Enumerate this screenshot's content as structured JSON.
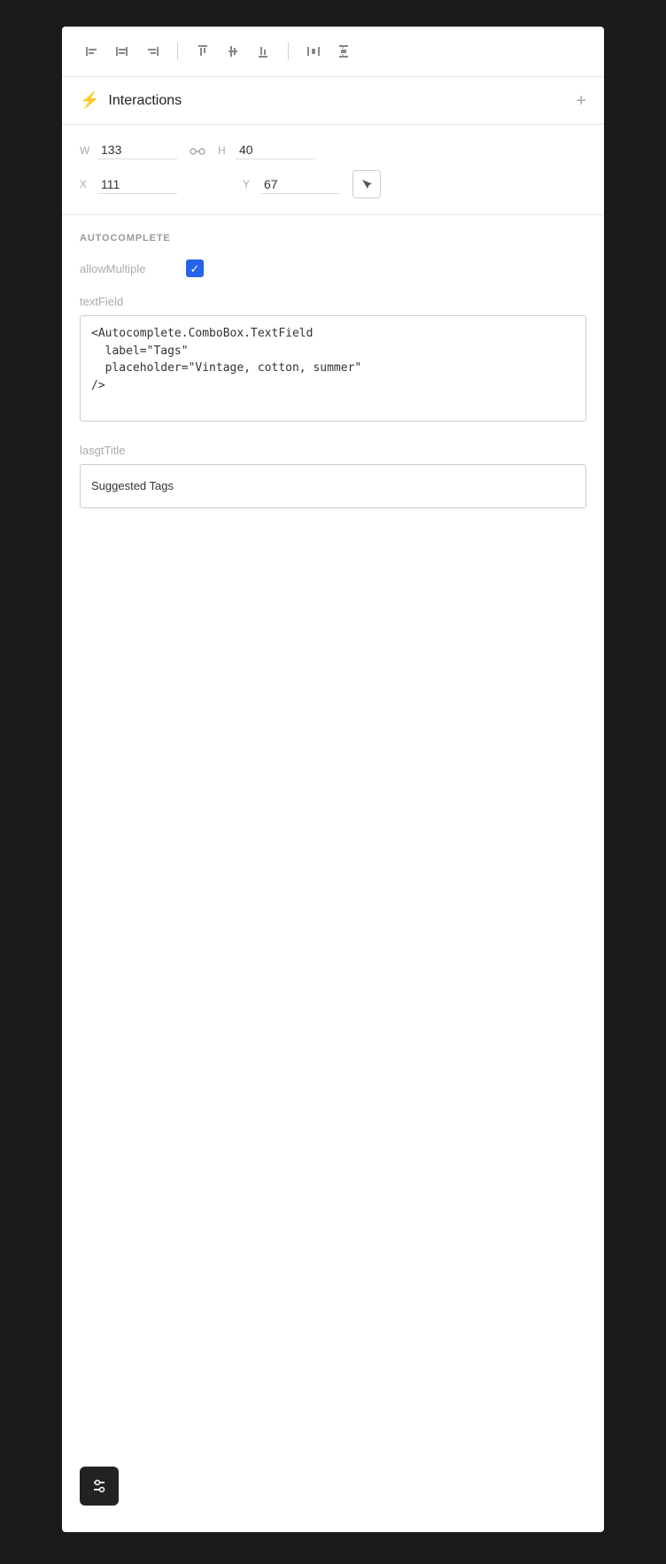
{
  "toolbar": {
    "icons": [
      {
        "name": "align-left-icon",
        "symbol": "⊢"
      },
      {
        "name": "align-center-v-icon",
        "symbol": "⊥"
      },
      {
        "name": "align-right-icon",
        "symbol": "⊣"
      },
      {
        "name": "align-top-icon",
        "symbol": "⊤"
      },
      {
        "name": "align-center-h-icon",
        "symbol": "⊕"
      },
      {
        "name": "align-bottom-icon",
        "symbol": "⊥"
      },
      {
        "name": "distribute-h-icon",
        "symbol": "⊞"
      },
      {
        "name": "distribute-v-icon",
        "symbol": "⊟"
      }
    ]
  },
  "interactions_header": {
    "title": "Interactions",
    "add_label": "+",
    "lightning_symbol": "⚡"
  },
  "dimensions": {
    "w_label": "W",
    "w_value": "133",
    "h_label": "H",
    "h_value": "40",
    "x_label": "X",
    "x_value": "111",
    "y_label": "Y",
    "y_value": "67",
    "link_symbol": "⛓",
    "cursor_symbol": "↖"
  },
  "autocomplete": {
    "section_label": "AUTOCOMPLETE",
    "allow_multiple_label": "allowMultiple",
    "allow_multiple_checked": true,
    "text_field_label": "textField",
    "text_field_value": "<Autocomplete.ComboBox.TextField\n  label=\"Tags\"\n  placeholder=\"Vintage, cotton, summer\"\n/>",
    "lasgt_title_label": "lasgtTitle",
    "lasgt_title_value": "Suggested Tags"
  },
  "bottom_toolbar": {
    "icon_symbol": "⇅",
    "label": "adjust-icon"
  }
}
